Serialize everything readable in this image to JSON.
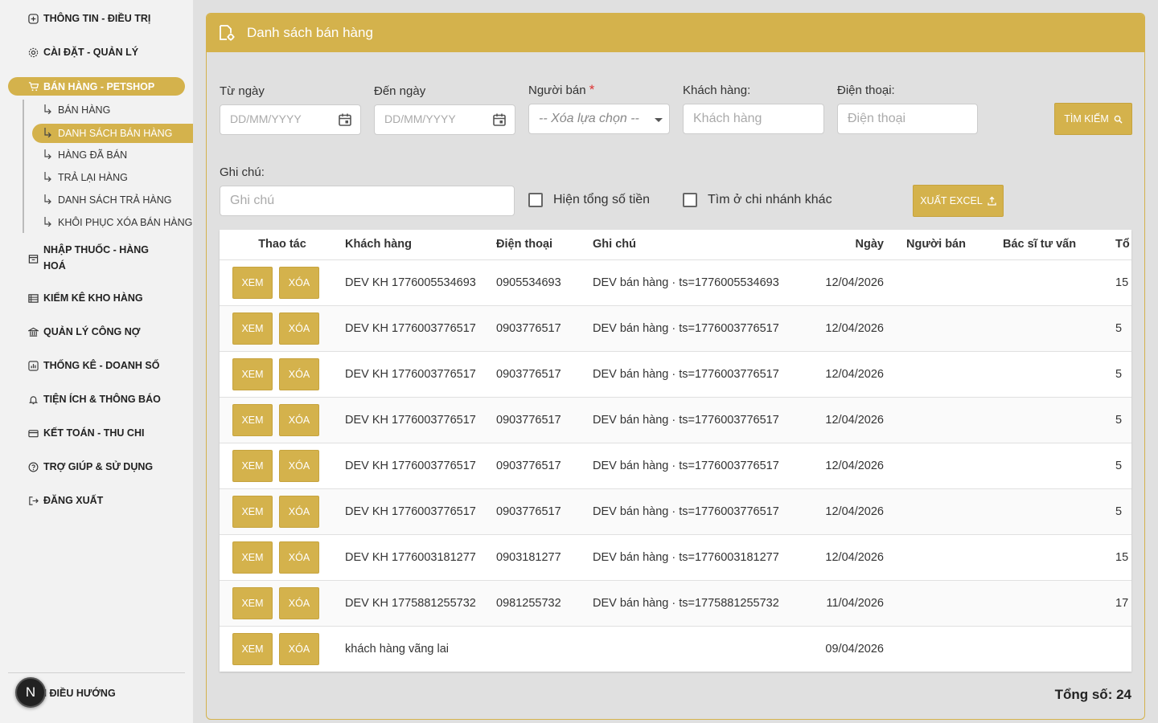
{
  "sidebar": {
    "items": [
      {
        "label": "THÔNG TIN - ĐIỀU TRỊ",
        "icon": "medical-icon"
      },
      {
        "label": "CÀI ĐẶT - QUẢN LÝ",
        "icon": "gear-icon"
      },
      {
        "label": "BÁN HÀNG - PETSHOP",
        "icon": "cart-icon"
      },
      {
        "label": "NHẬP THUỐC - HÀNG HOÁ",
        "icon": "box-icon"
      },
      {
        "label": "KIỂM KÊ KHO HÀNG",
        "icon": "list-icon"
      },
      {
        "label": "QUẢN LÝ CÔNG NỢ",
        "icon": "bank-icon"
      },
      {
        "label": "THỐNG KÊ - DOANH SỐ",
        "icon": "chart-icon"
      },
      {
        "label": "TIỆN ÍCH & THÔNG BÁO",
        "icon": "bell-icon"
      },
      {
        "label": "KẾT TOÁN - THU CHI",
        "icon": "card-icon"
      },
      {
        "label": "TRỢ GIÚP & SỬ DỤNG",
        "icon": "help-icon"
      },
      {
        "label": "ĐĂNG XUẤT",
        "icon": "logout-icon"
      }
    ],
    "sub_items": [
      {
        "label": "BÁN HÀNG"
      },
      {
        "label": "DANH SÁCH BÁN HÀNG"
      },
      {
        "label": "HÀNG ĐÃ BÁN"
      },
      {
        "label": "TRẢ LẠI HÀNG"
      },
      {
        "label": "DANH SÁCH TRẢ HÀNG"
      },
      {
        "label": "KHÔI PHỤC XÓA BÁN HÀNG"
      }
    ],
    "avatar_letter": "N",
    "hide_nav_label": "ẨN ĐIỀU HƯỚNG"
  },
  "page": {
    "title": "Danh sách bán hàng"
  },
  "filters": {
    "from_label": "Từ ngày",
    "from_placeholder": "DD/MM/YYYY",
    "to_label": "Đến ngày",
    "to_placeholder": "DD/MM/YYYY",
    "seller_label": "Người bán",
    "seller_required": "*",
    "seller_value": "-- Xóa lựa chọn --",
    "customer_label": "Khách hàng:",
    "customer_placeholder": "Khách hàng",
    "phone_label": "Điện thoại:",
    "phone_placeholder": "Điện thoại",
    "search_button": "TÌM KIẾM",
    "note_label": "Ghi chú:",
    "note_placeholder": "Ghi chú",
    "show_total_label": "Hiện tổng số tiền",
    "other_branch_label": "Tìm ở chi nhánh khác",
    "export_button": "XUẤT EXCEL"
  },
  "table": {
    "headers": {
      "actions": "Thao tác",
      "customer": "Khách hàng",
      "phone": "Điện thoại",
      "note": "Ghi chú",
      "date": "Ngày",
      "seller": "Người bán",
      "doctor": "Bác sĩ tư vấn",
      "total": "Tổ"
    },
    "view_label": "XEM",
    "delete_label": "XÓA",
    "rows": [
      {
        "customer": "DEV KH 1776005534693",
        "phone": "0905534693",
        "note": "DEV bán hàng · ts=1776005534693",
        "date": "12/04/2026",
        "seller": "",
        "doctor": "",
        "total": "15"
      },
      {
        "customer": "DEV KH 1776003776517",
        "phone": "0903776517",
        "note": "DEV bán hàng · ts=1776003776517",
        "date": "12/04/2026",
        "seller": "",
        "doctor": "",
        "total": "5"
      },
      {
        "customer": "DEV KH 1776003776517",
        "phone": "0903776517",
        "note": "DEV bán hàng · ts=1776003776517",
        "date": "12/04/2026",
        "seller": "",
        "doctor": "",
        "total": "5"
      },
      {
        "customer": "DEV KH 1776003776517",
        "phone": "0903776517",
        "note": "DEV bán hàng · ts=1776003776517",
        "date": "12/04/2026",
        "seller": "",
        "doctor": "",
        "total": "5"
      },
      {
        "customer": "DEV KH 1776003776517",
        "phone": "0903776517",
        "note": "DEV bán hàng · ts=1776003776517",
        "date": "12/04/2026",
        "seller": "",
        "doctor": "",
        "total": "5"
      },
      {
        "customer": "DEV KH 1776003776517",
        "phone": "0903776517",
        "note": "DEV bán hàng · ts=1776003776517",
        "date": "12/04/2026",
        "seller": "",
        "doctor": "",
        "total": "5"
      },
      {
        "customer": "DEV KH 1776003181277",
        "phone": "0903181277",
        "note": "DEV bán hàng · ts=1776003181277",
        "date": "12/04/2026",
        "seller": "",
        "doctor": "",
        "total": "15"
      },
      {
        "customer": "DEV KH 1775881255732",
        "phone": "0981255732",
        "note": "DEV bán hàng · ts=1775881255732",
        "date": "11/04/2026",
        "seller": "",
        "doctor": "",
        "total": "17"
      },
      {
        "customer": "khách hàng vãng lai",
        "phone": "",
        "note": "",
        "date": "09/04/2026",
        "seller": "",
        "doctor": "",
        "total": ""
      }
    ]
  },
  "footer": {
    "total_label": "Tổng số: 24"
  },
  "colors": {
    "accent": "#d4b24c",
    "background": "#e0e0e0"
  }
}
